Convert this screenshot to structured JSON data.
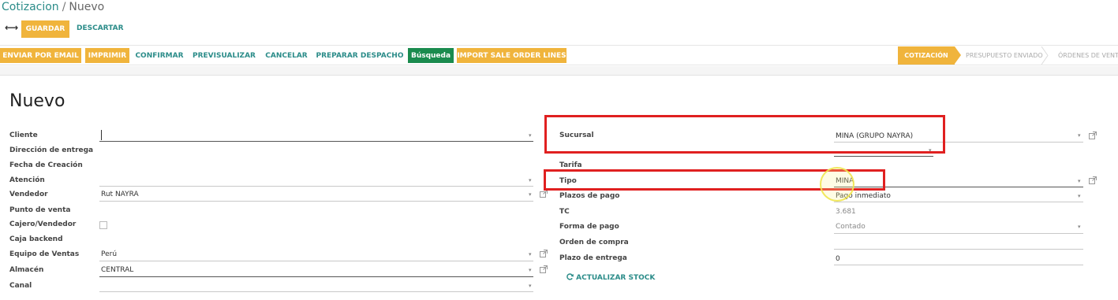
{
  "breadcrumb": {
    "parent": "Cotizacion",
    "separator": "/",
    "current": "Nuevo"
  },
  "toolbar": {
    "back_glyph": "⟷",
    "save_label": "GUARDAR",
    "discard_label": "DESCARTAR"
  },
  "actions": [
    {
      "label": "ENVIAR POR EMAIL",
      "style": "orange"
    },
    {
      "label": "IMPRIMIR",
      "style": "orange"
    },
    {
      "label": "CONFIRMAR",
      "style": "link"
    },
    {
      "label": "PREVISUALIZAR",
      "style": "link"
    },
    {
      "label": "CANCELAR",
      "style": "link"
    },
    {
      "label": "PREPARAR DESPACHO",
      "style": "link"
    },
    {
      "label": "Búsqueda",
      "style": "green"
    },
    {
      "label": "IMPORT SALE ORDER LINES",
      "style": "orange"
    }
  ],
  "statusbar": {
    "steps": [
      "COTIZACIÓN",
      "PRESUPUESTO ENVIADO",
      "ÓRDENES DE VENTA"
    ],
    "active_index": 0
  },
  "form": {
    "title": "Nuevo",
    "left": {
      "cliente": {
        "label": "Cliente",
        "value": ""
      },
      "direccion": {
        "label": "Dirección de entrega"
      },
      "fecha": {
        "label": "Fecha de Creación"
      },
      "atencion": {
        "label": "Atención",
        "value": ""
      },
      "vendedor": {
        "label": "Vendedor",
        "value": "Rut NAYRA"
      },
      "punto": {
        "label": "Punto de venta"
      },
      "cajero": {
        "label": "Cajero/Vendedor"
      },
      "caja": {
        "label": "Caja backend"
      },
      "equipo": {
        "label": "Equipo de Ventas",
        "value": "Perú"
      },
      "almacen": {
        "label": "Almacén",
        "value": "CENTRAL"
      },
      "canal": {
        "label": "Canal",
        "value": ""
      }
    },
    "right": {
      "sucursal": {
        "label": "Sucursal",
        "value": "MINA (GRUPO NAYRA)"
      },
      "tarifa": {
        "label": "Tarifa"
      },
      "tipo": {
        "label": "Tipo",
        "value": "MINA"
      },
      "plazos": {
        "label": "Plazos de pago",
        "value": "Pago inmediato"
      },
      "tc": {
        "label": "TC",
        "value": "3.681"
      },
      "forma": {
        "label": "Forma de pago",
        "value": "Contado"
      },
      "orden": {
        "label": "Orden de compra",
        "value": ""
      },
      "plazo_entrega": {
        "label": "Plazo de entrega",
        "value": "0"
      },
      "refresh": {
        "label": "ACTUALIZAR STOCK"
      }
    }
  },
  "colors": {
    "accent": "#2b8c89",
    "orange": "#f0b43c",
    "green": "#1a8b4e",
    "annotation_red": "#e02020"
  }
}
